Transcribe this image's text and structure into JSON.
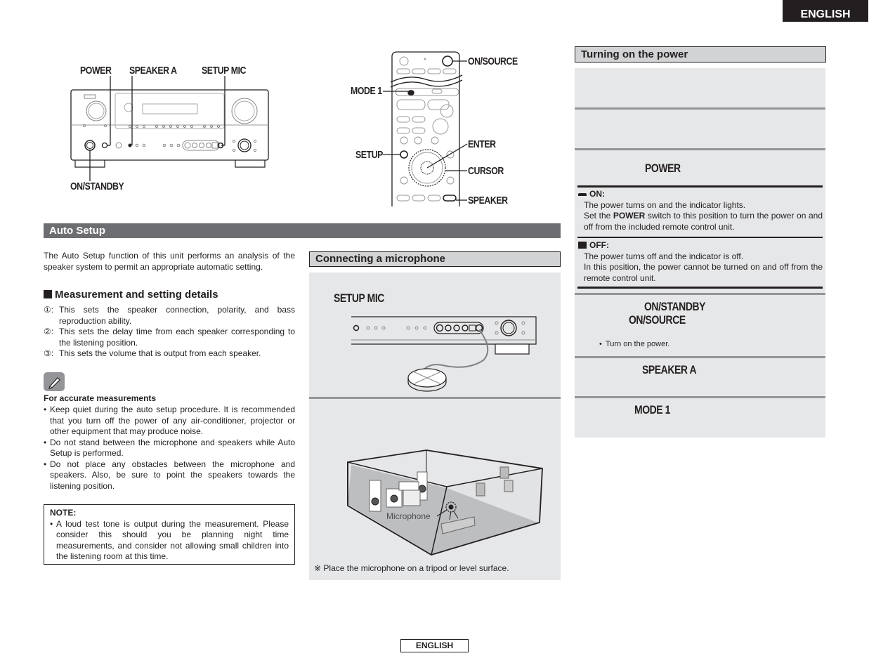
{
  "header": {
    "language_tab": "ENGLISH"
  },
  "footer": {
    "language_label": "ENGLISH"
  },
  "receiver_diagram": {
    "callouts": [
      "POWER",
      "SPEAKER A",
      "SETUP MIC",
      "ON/STANDBY"
    ]
  },
  "remote_diagram": {
    "callouts_right": [
      "ON/SOURCE",
      "ENTER",
      "CURSOR",
      "SPEAKER"
    ],
    "callouts_left": [
      "MODE 1",
      "SETUP"
    ]
  },
  "auto_setup": {
    "title": "Auto Setup",
    "intro": "The Auto Setup function of this unit performs an analysis of the speaker system to permit an appropriate automatic setting.",
    "measurement_heading": "Measurement and setting details",
    "measurement_items": [
      {
        "num": "①:",
        "text": "This sets the speaker connection, polarity, and bass reproduction ability."
      },
      {
        "num": "②:",
        "text": "This sets the delay time from each speaker corresponding to the listening position."
      },
      {
        "num": "③:",
        "text": "This sets the volume that is output from each speaker."
      }
    ],
    "tip_icon": "pencil-icon",
    "tips_heading": "For accurate measurements",
    "tips": [
      "Keep quiet during the auto setup procedure. It is recommended that you turn off the power of any air-conditioner, projector or other equipment that may produce noise.",
      "Do not stand between the microphone and speakers while Auto Setup is performed.",
      "Do not place any obstacles between the microphone and speakers. Also, be sure to point the speakers towards the listening position."
    ],
    "note_heading": "NOTE:",
    "note_items": [
      "A loud test tone is output during the measurement. Please consider this should you be planning night time measurements, and consider not allowing small children into the listening room at this time."
    ]
  },
  "connecting_mic": {
    "title": "Connecting a microphone",
    "step1_label": "SETUP MIC",
    "room_mic_label": "Microphone",
    "footnote_mark": "※",
    "footnote": "Place the microphone on a tripod or level surface."
  },
  "turning_on": {
    "title": "Turning on the power",
    "step3_label": "POWER",
    "on_label": "ON:",
    "on_lines": [
      "The power turns on and the indicator lights.",
      "Set the",
      "POWER",
      "switch to this position to turn the power on and off from the included remote control unit."
    ],
    "off_label": "OFF:",
    "off_lines": [
      "The power turns off and the indicator is off.",
      "In this position, the power cannot be turned on and off from the remote control unit."
    ],
    "step4_label1": "ON/STANDBY",
    "step4_label2": "ON/SOURCE",
    "step4_bullet": "Turn on the power.",
    "step5_label": "SPEAKER A",
    "step6_label": "MODE 1"
  }
}
